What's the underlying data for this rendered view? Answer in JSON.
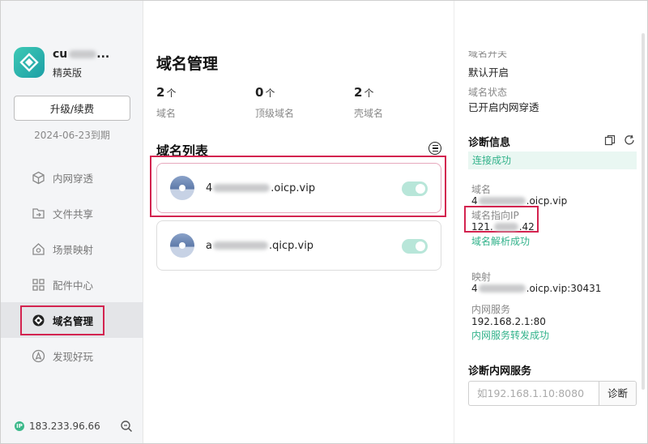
{
  "titlebar": {
    "icons": [
      "qrcode-icon",
      "menu-icon",
      "close-icon"
    ]
  },
  "sidebar": {
    "user_name": "cu",
    "user_name_suffix": "...",
    "plan": "精英版",
    "upgrade_label": "升级/续费",
    "expire_text": "2024-06-23到期",
    "items": [
      {
        "label": "内网穿透",
        "icon": "cube-icon",
        "active": false
      },
      {
        "label": "文件共享",
        "icon": "folder-share-icon",
        "active": false
      },
      {
        "label": "场景映射",
        "icon": "house-icon",
        "active": false
      },
      {
        "label": "配件中心",
        "icon": "grid-icon",
        "active": false
      },
      {
        "label": "域名管理",
        "icon": "domain-icon",
        "active": true
      },
      {
        "label": "发现好玩",
        "icon": "discover-icon",
        "active": false
      }
    ],
    "footer_ip_badge": "IP",
    "footer_ip": "183.233.96.66"
  },
  "main": {
    "title": "域名管理",
    "stats": [
      {
        "num": "2",
        "unit": "个",
        "label": "域名"
      },
      {
        "num": "0",
        "unit": "个",
        "label": "顶级域名"
      },
      {
        "num": "2",
        "unit": "个",
        "label": "壳域名"
      }
    ],
    "list_title": "域名列表",
    "domains": [
      {
        "prefix": "4",
        "suffix": ".oicp.vip",
        "enabled": true,
        "selected": true
      },
      {
        "prefix": "a",
        "suffix": ".qicp.vip",
        "enabled": true,
        "selected": false
      }
    ]
  },
  "detail": {
    "switch_label": "域名开关",
    "switch_value": "默认开启",
    "status_label": "域名状态",
    "status_value": "已开启内网穿透",
    "diag_title": "诊断信息",
    "connect_ok": "连接成功",
    "domain_label": "域名",
    "domain_prefix": "4",
    "domain_suffix": ".oicp.vip",
    "ip_label": "域名指向IP",
    "ip_prefix": "121.",
    "ip_suffix": ".42",
    "resolve_ok": "域名解析成功",
    "mapping_label": "映射",
    "mapping_prefix": "4",
    "mapping_suffix": ".oicp.vip:30431",
    "lan_label": "内网服务",
    "lan_value": "192.168.2.1:80",
    "forward_ok": "内网服务转发成功",
    "diag_lan_title": "诊断内网服务",
    "diag_placeholder": "如192.168.1.10:8080",
    "diag_button": "诊断",
    "accent_color": "#31b28a",
    "highlight_color": "#d3234f"
  }
}
